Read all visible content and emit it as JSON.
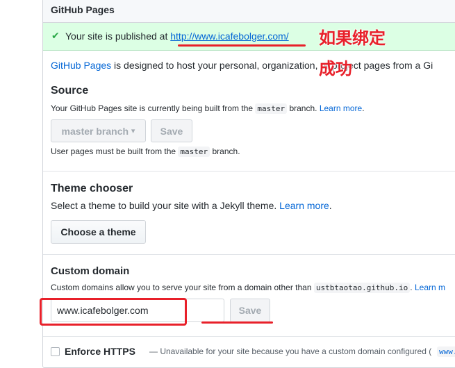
{
  "panel": {
    "title": "GitHub Pages",
    "flash": {
      "check_icon": "✔",
      "prefix": "Your site is published at ",
      "url": "http://www.icafebolger.com/"
    },
    "intro": {
      "link": "GitHub Pages",
      "text": " is designed to host your personal, organization, or project pages from a Gi"
    }
  },
  "source": {
    "heading": "Source",
    "note_prefix": "Your GitHub Pages site is currently being built from the ",
    "note_code": "master",
    "note_suffix": " branch. ",
    "learn_more": "Learn more",
    "learn_more_dot": ".",
    "branch_select": "master branch",
    "branch_caret": "▾",
    "save_label": "Save",
    "hint_prefix": "User pages must be built from the ",
    "hint_code": "master",
    "hint_suffix": " branch."
  },
  "theme": {
    "heading": "Theme chooser",
    "desc_prefix": "Select a theme to build your site with a Jekyll theme. ",
    "learn_more": "Learn more",
    "learn_more_dot": ".",
    "button": "Choose a theme"
  },
  "custom_domain": {
    "heading": "Custom domain",
    "note_prefix": "Custom domains allow you to serve your site from a domain other than ",
    "note_code": "ustbtaotao.github.io",
    "note_suffix": ". ",
    "learn_more": "Learn m",
    "input_value": "www.icafebolger.com",
    "save_label": "Save"
  },
  "https": {
    "label": "Enforce HTTPS",
    "note": "— Unavailable for your site because you have a custom domain configured (",
    "code": "www."
  },
  "annotations": {
    "line1": "如果绑定",
    "line2": "成功",
    "color": "#e8202a"
  }
}
